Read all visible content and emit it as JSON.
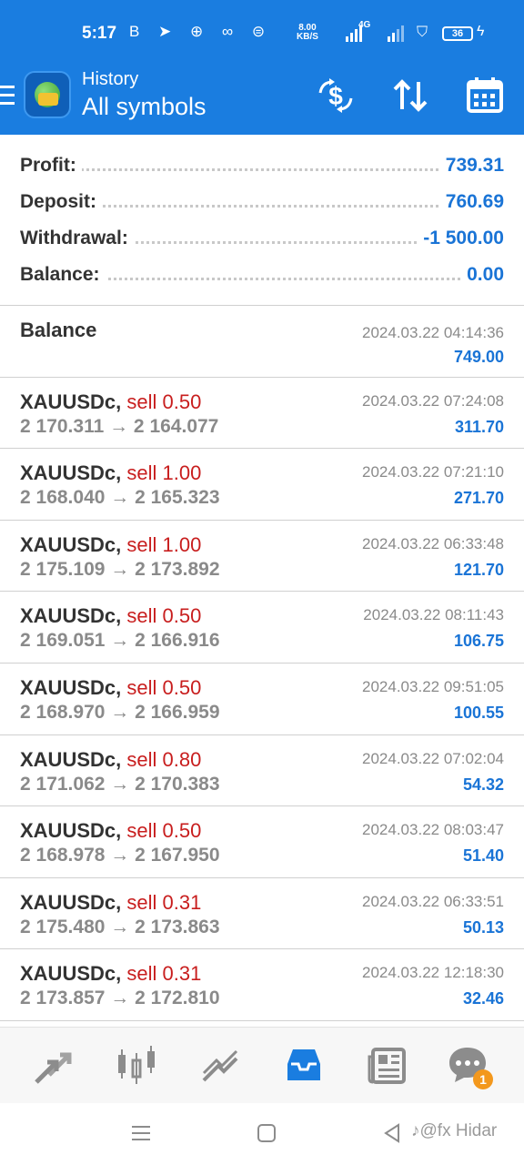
{
  "status": {
    "time": "5:17",
    "icons_text": "B ➤ ⊕ ∞ ⊜",
    "speed_value": "8.00",
    "speed_unit": "KB/S",
    "net_label": "4G",
    "battery": "36"
  },
  "header": {
    "subtitle": "History",
    "title": "All symbols"
  },
  "summary": {
    "profit_label": "Profit:",
    "profit_value": "739.31",
    "deposit_label": "Deposit:",
    "deposit_value": "760.69",
    "withdrawal_label": "Withdrawal:",
    "withdrawal_value": "-1 500.00",
    "balance_label": "Balance:",
    "balance_value": "0.00"
  },
  "balance_entry": {
    "label": "Balance",
    "time": "2024.03.22 04:14:36",
    "amount": "749.00"
  },
  "trades": [
    {
      "symbol": "XAUUSDc,",
      "side": "sell 0.50",
      "prices": "2 170.311 → 2 164.077",
      "time": "2024.03.22 07:24:08",
      "profit": "311.70"
    },
    {
      "symbol": "XAUUSDc,",
      "side": "sell 1.00",
      "prices": "2 168.040 → 2 165.323",
      "time": "2024.03.22 07:21:10",
      "profit": "271.70"
    },
    {
      "symbol": "XAUUSDc,",
      "side": "sell 1.00",
      "prices": "2 175.109 → 2 173.892",
      "time": "2024.03.22 06:33:48",
      "profit": "121.70"
    },
    {
      "symbol": "XAUUSDc,",
      "side": "sell 0.50",
      "prices": "2 169.051 → 2 166.916",
      "time": "2024.03.22 08:11:43",
      "profit": "106.75"
    },
    {
      "symbol": "XAUUSDc,",
      "side": "sell 0.50",
      "prices": "2 168.970 → 2 166.959",
      "time": "2024.03.22 09:51:05",
      "profit": "100.55"
    },
    {
      "symbol": "XAUUSDc,",
      "side": "sell 0.80",
      "prices": "2 171.062 → 2 170.383",
      "time": "2024.03.22 07:02:04",
      "profit": "54.32"
    },
    {
      "symbol": "XAUUSDc,",
      "side": "sell 0.50",
      "prices": "2 168.978 → 2 167.950",
      "time": "2024.03.22 08:03:47",
      "profit": "51.40"
    },
    {
      "symbol": "XAUUSDc,",
      "side": "sell 0.31",
      "prices": "2 175.480 → 2 173.863",
      "time": "2024.03.22 06:33:51",
      "profit": "50.13"
    },
    {
      "symbol": "XAUUSDc,",
      "side": "sell 0.31",
      "prices": "2 173.857 → 2 172.810",
      "time": "2024.03.22 12:18:30",
      "profit": "32.46"
    }
  ],
  "bottom_nav": {
    "chat_badge": "1"
  },
  "watermark": "♪@fx Hidar",
  "colors": {
    "brand_blue": "#1a7de0",
    "value_blue": "#1a74d6",
    "sell_red": "#c81e1e",
    "badge_orange": "#f3981d"
  }
}
